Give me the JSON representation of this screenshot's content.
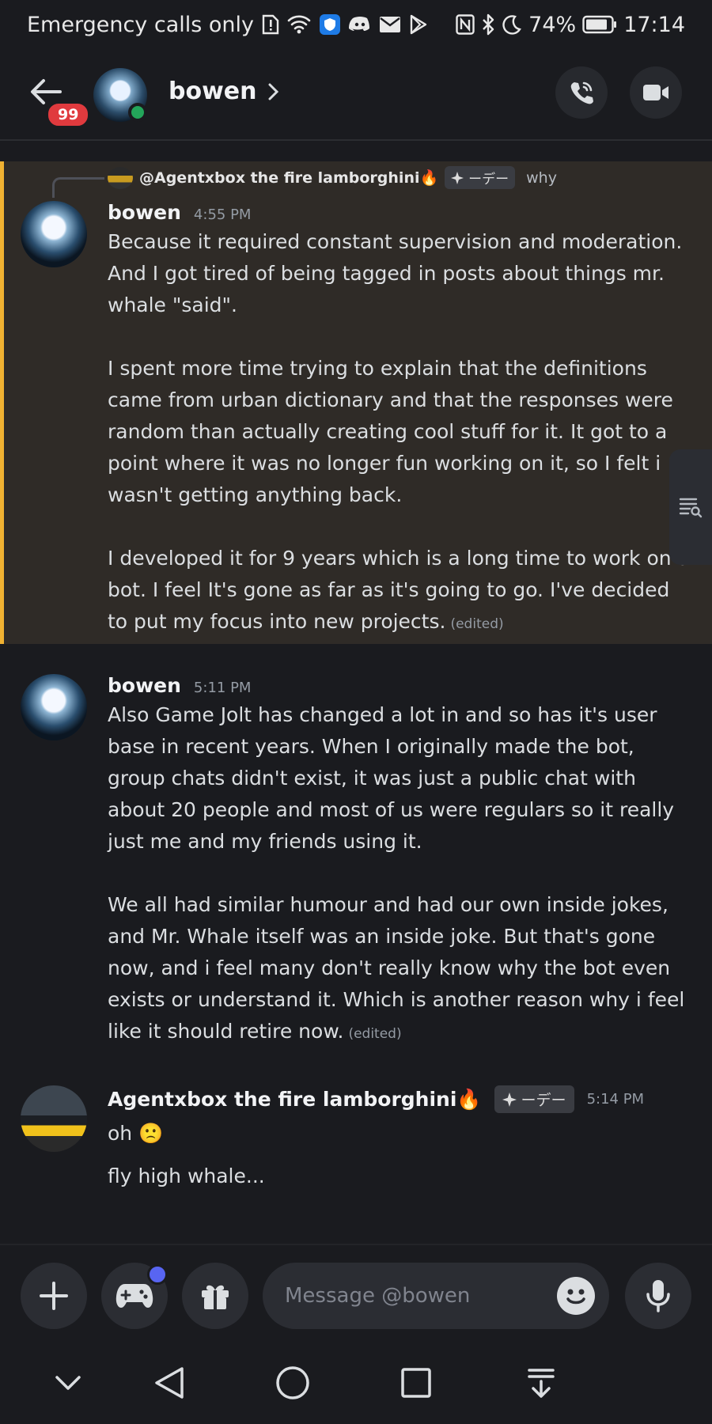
{
  "status_bar": {
    "carrier": "Emergency calls only",
    "battery": "74%",
    "time": "17:14"
  },
  "header": {
    "unread_badge": "99",
    "title": "bowen",
    "status": "online",
    "status_color": "#23a55a"
  },
  "messages": [
    {
      "author": "bowen",
      "time": "4:55 PM",
      "highlighted": true,
      "reply": {
        "author": "@Agentxbox the fire lamborghini🔥",
        "role_tag": "ーデー",
        "text": "why"
      },
      "paragraphs": [
        "Because it required constant supervision and moderation. And I got tired of being tagged in posts about things mr. whale \"said\".",
        "I spent more time trying to explain that the definitions came from urban dictionary and that the responses were random than actually creating cool stuff for it. It got to a point where it was no longer fun working on it, so I felt i wasn't getting anything back.",
        "I developed it for 9 years which is a long time to work on a bot. I feel It's gone as far as it's going to go. I've decided to put my focus into new projects."
      ],
      "edited": "(edited)"
    },
    {
      "author": "bowen",
      "time": "5:11 PM",
      "paragraphs": [
        "Also Game Jolt has changed a lot in and so has it's user base in recent years. When I originally made the bot, group chats didn't exist, it was just a public chat with about 20 people and most of us were regulars so it really just me and my friends using it.",
        "We all had similar humour and had our own inside jokes, and Mr. Whale itself was an inside joke. But that's gone now, and i feel many don't really know why the bot even exists or understand it. Which is another reason why i feel like it should retire now."
      ],
      "edited": "(edited)"
    },
    {
      "author": "Agentxbox the fire lamborghini🔥",
      "role_tag": "ーデー",
      "time": "5:14 PM",
      "lines": [
        "oh 🙁",
        "fly high whale..."
      ]
    }
  ],
  "composer": {
    "placeholder": "Message @bowen"
  },
  "colors": {
    "background": "#1a1b1f",
    "highlight_bg": "#2f2b27",
    "highlight_border": "#f0b232",
    "accent": "#5865f2",
    "badge": "#e03a3e"
  }
}
